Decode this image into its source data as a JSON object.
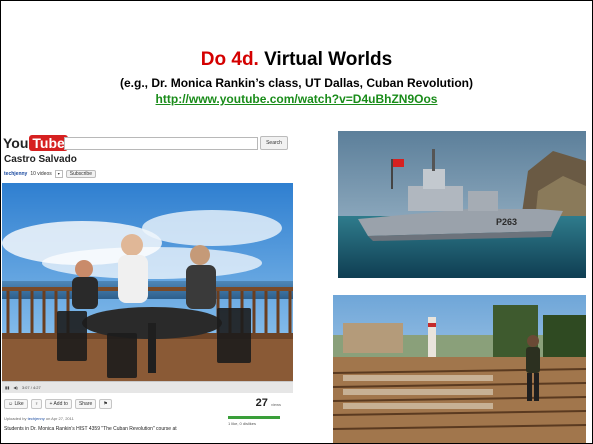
{
  "slide": {
    "title_accent": "Do 4d.",
    "title_rest": " Virtual Worlds",
    "subtitle": "(e.g., Dr. Monica Rankin’s class, UT Dallas, Cuban Revolution)",
    "link": "http://www.youtube.com/watch?v=D4uBhZN9Oos"
  },
  "youtube": {
    "logo_you": "You",
    "logo_tube": "Tube",
    "search_button": "Search",
    "video_title": "Castro Salvado",
    "user": "techjenny",
    "videos_count": "10 videos",
    "subscribe": "Subscribe",
    "time": "3:07 / 4:27",
    "like": "Like",
    "add_to": "+ Add to",
    "share": "Share",
    "views": "27",
    "views_label": "views",
    "uploaded_prefix": "Uploaded by",
    "uploaded_suffix": "on Apr 27, 2011",
    "likes_text": "1 like, 0 dislikes",
    "description": "Students in Dr. Monica Rankin’s HIST 4359 \"The Cuban Revolution\" course at"
  },
  "images": {
    "ship_hull": "P263"
  }
}
